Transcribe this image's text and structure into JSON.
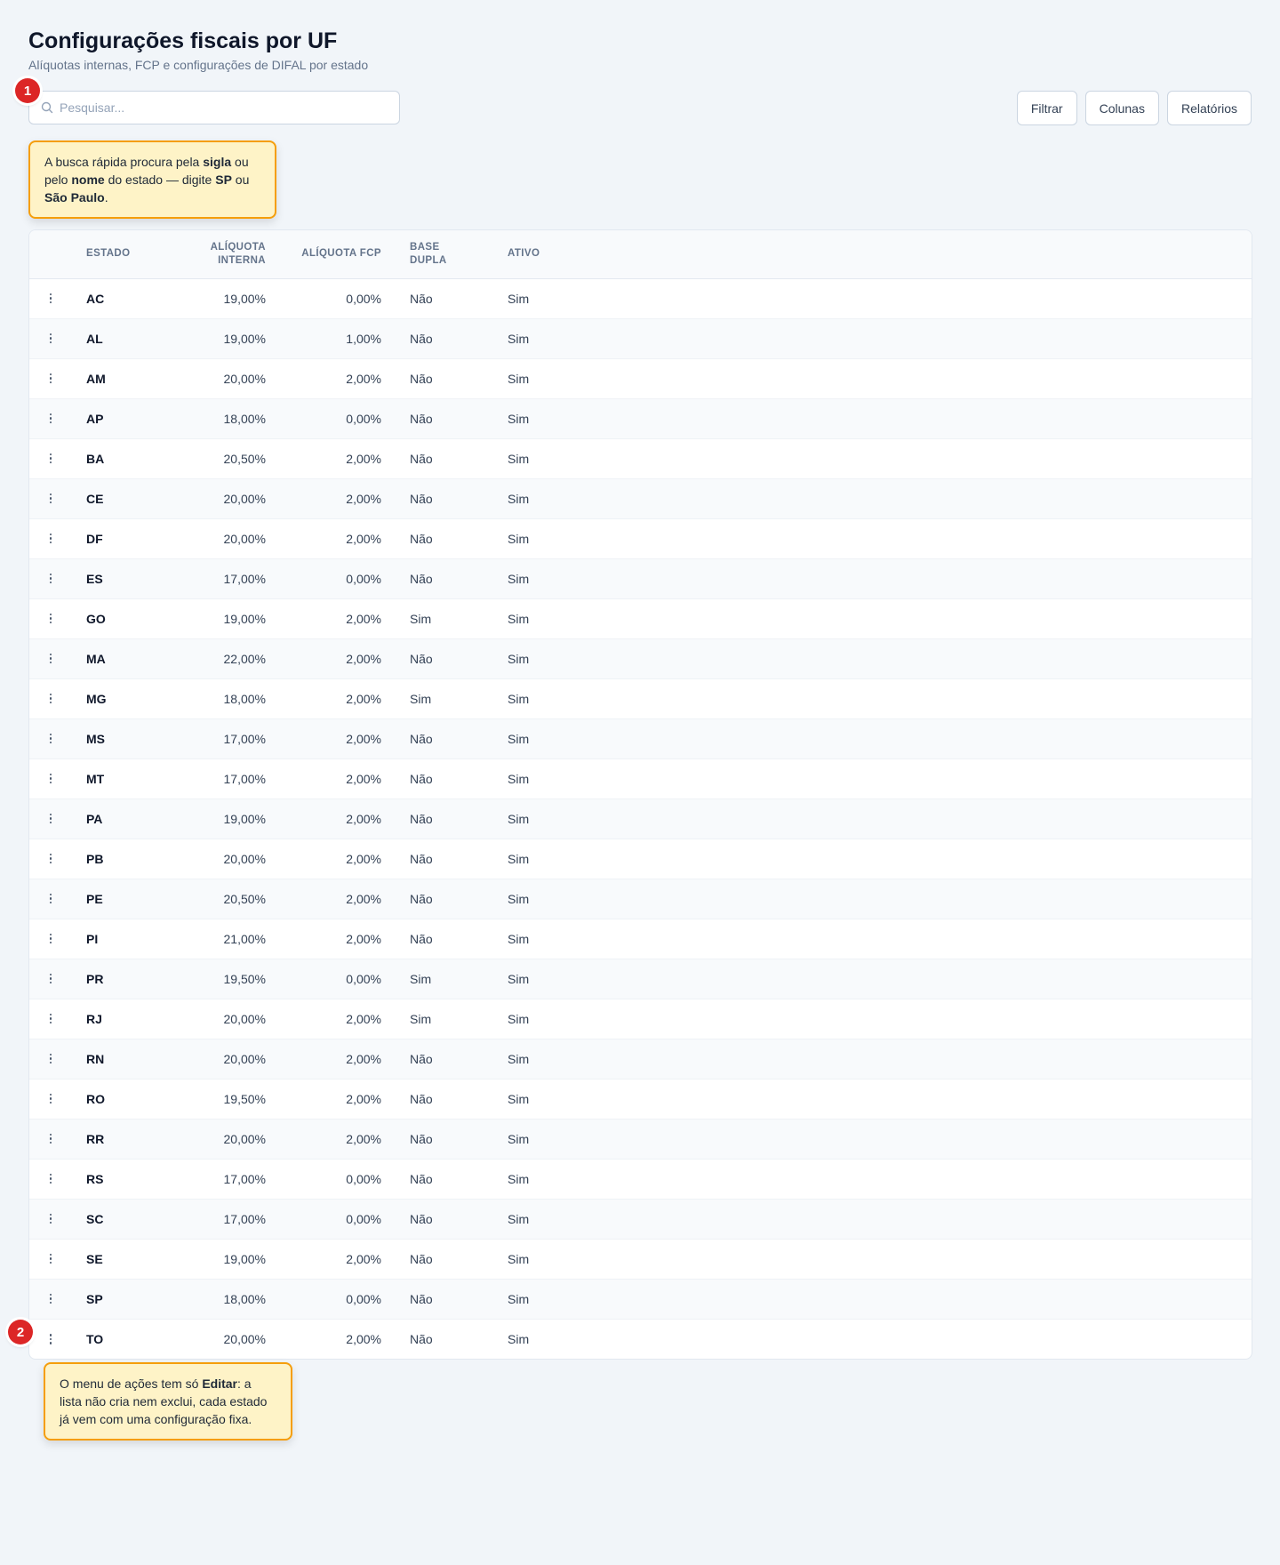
{
  "header": {
    "title": "Configurações fiscais por UF",
    "subtitle": "Alíquotas internas, FCP e configurações de DIFAL por estado"
  },
  "search": {
    "placeholder": "Pesquisar..."
  },
  "toolbar": {
    "filter_label": "Filtrar",
    "columns_label": "Colunas",
    "reports_label": "Relatórios"
  },
  "annotations": {
    "marker1": "1",
    "marker2": "2",
    "tip1": {
      "t1": "A busca rápida procura pela ",
      "b1": "sigla",
      "t2": " ou pelo ",
      "b2": "nome",
      "t3": " do estado — digite ",
      "b3": "SP",
      "t4": " ou ",
      "b4": "São Paulo",
      "t5": "."
    },
    "tip2": {
      "t1": "O menu de ações tem só ",
      "b1": "Editar",
      "t2": ": a lista não cria nem exclui, cada estado já vem com uma configuração fixa."
    }
  },
  "table": {
    "headers": {
      "estado": "ESTADO",
      "aliquota_interna_l1": "ALÍQUOTA",
      "aliquota_interna_l2": "INTERNA",
      "aliquota_fcp": "ALÍQUOTA FCP",
      "base_dupla_l1": "BASE",
      "base_dupla_l2": "DUPLA",
      "ativo": "ATIVO"
    },
    "rows": [
      {
        "uf": "AC",
        "interna": "19,00%",
        "fcp": "0,00%",
        "base_dupla": "Não",
        "ativo": "Sim"
      },
      {
        "uf": "AL",
        "interna": "19,00%",
        "fcp": "1,00%",
        "base_dupla": "Não",
        "ativo": "Sim"
      },
      {
        "uf": "AM",
        "interna": "20,00%",
        "fcp": "2,00%",
        "base_dupla": "Não",
        "ativo": "Sim"
      },
      {
        "uf": "AP",
        "interna": "18,00%",
        "fcp": "0,00%",
        "base_dupla": "Não",
        "ativo": "Sim"
      },
      {
        "uf": "BA",
        "interna": "20,50%",
        "fcp": "2,00%",
        "base_dupla": "Não",
        "ativo": "Sim"
      },
      {
        "uf": "CE",
        "interna": "20,00%",
        "fcp": "2,00%",
        "base_dupla": "Não",
        "ativo": "Sim"
      },
      {
        "uf": "DF",
        "interna": "20,00%",
        "fcp": "2,00%",
        "base_dupla": "Não",
        "ativo": "Sim"
      },
      {
        "uf": "ES",
        "interna": "17,00%",
        "fcp": "0,00%",
        "base_dupla": "Não",
        "ativo": "Sim"
      },
      {
        "uf": "GO",
        "interna": "19,00%",
        "fcp": "2,00%",
        "base_dupla": "Sim",
        "ativo": "Sim"
      },
      {
        "uf": "MA",
        "interna": "22,00%",
        "fcp": "2,00%",
        "base_dupla": "Não",
        "ativo": "Sim"
      },
      {
        "uf": "MG",
        "interna": "18,00%",
        "fcp": "2,00%",
        "base_dupla": "Sim",
        "ativo": "Sim"
      },
      {
        "uf": "MS",
        "interna": "17,00%",
        "fcp": "2,00%",
        "base_dupla": "Não",
        "ativo": "Sim"
      },
      {
        "uf": "MT",
        "interna": "17,00%",
        "fcp": "2,00%",
        "base_dupla": "Não",
        "ativo": "Sim"
      },
      {
        "uf": "PA",
        "interna": "19,00%",
        "fcp": "2,00%",
        "base_dupla": "Não",
        "ativo": "Sim"
      },
      {
        "uf": "PB",
        "interna": "20,00%",
        "fcp": "2,00%",
        "base_dupla": "Não",
        "ativo": "Sim"
      },
      {
        "uf": "PE",
        "interna": "20,50%",
        "fcp": "2,00%",
        "base_dupla": "Não",
        "ativo": "Sim"
      },
      {
        "uf": "PI",
        "interna": "21,00%",
        "fcp": "2,00%",
        "base_dupla": "Não",
        "ativo": "Sim"
      },
      {
        "uf": "PR",
        "interna": "19,50%",
        "fcp": "0,00%",
        "base_dupla": "Sim",
        "ativo": "Sim"
      },
      {
        "uf": "RJ",
        "interna": "20,00%",
        "fcp": "2,00%",
        "base_dupla": "Sim",
        "ativo": "Sim"
      },
      {
        "uf": "RN",
        "interna": "20,00%",
        "fcp": "2,00%",
        "base_dupla": "Não",
        "ativo": "Sim"
      },
      {
        "uf": "RO",
        "interna": "19,50%",
        "fcp": "2,00%",
        "base_dupla": "Não",
        "ativo": "Sim"
      },
      {
        "uf": "RR",
        "interna": "20,00%",
        "fcp": "2,00%",
        "base_dupla": "Não",
        "ativo": "Sim"
      },
      {
        "uf": "RS",
        "interna": "17,00%",
        "fcp": "0,00%",
        "base_dupla": "Não",
        "ativo": "Sim"
      },
      {
        "uf": "SC",
        "interna": "17,00%",
        "fcp": "0,00%",
        "base_dupla": "Não",
        "ativo": "Sim"
      },
      {
        "uf": "SE",
        "interna": "19,00%",
        "fcp": "2,00%",
        "base_dupla": "Não",
        "ativo": "Sim"
      },
      {
        "uf": "SP",
        "interna": "18,00%",
        "fcp": "0,00%",
        "base_dupla": "Não",
        "ativo": "Sim"
      },
      {
        "uf": "TO",
        "interna": "20,00%",
        "fcp": "2,00%",
        "base_dupla": "Não",
        "ativo": "Sim"
      }
    ]
  },
  "icons": {
    "search": "search-icon",
    "row_menu": "kebab-menu-icon"
  },
  "colors": {
    "marker": "#dc2626",
    "tip_bg": "#fef3c7",
    "tip_border": "#f59e0b",
    "page_bg": "#f1f5f9"
  }
}
